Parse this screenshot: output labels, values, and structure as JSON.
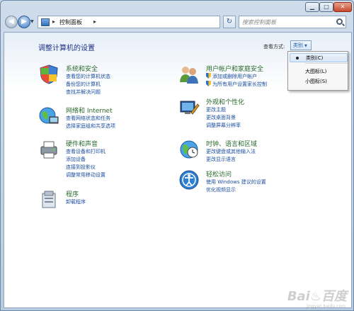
{
  "window": {
    "min_label": "▁",
    "max_label": "□",
    "close_label": "✕"
  },
  "nav": {
    "address_text": "控制面板",
    "search_placeholder": "搜索控制面板"
  },
  "page": {
    "title": "调整计算机的设置",
    "view_by_label": "查看方式:",
    "view_by_value": "类别"
  },
  "view_menu": {
    "items": [
      "类别(C)",
      "大图标(L)",
      "小图标(S)"
    ]
  },
  "categories": {
    "system": {
      "title": "系统和安全",
      "links": [
        "查看您的计算机状态",
        "备份您的计算机",
        "查找并解决问题"
      ]
    },
    "network": {
      "title": "网络和 Internet",
      "links": [
        "查看网络状态和任务",
        "选择家庭组和共享选项"
      ]
    },
    "hardware": {
      "title": "硬件和声音",
      "links": [
        "查看设备和打印机",
        "添加设备",
        "连接到投影仪",
        "调整常用移动设置"
      ]
    },
    "programs": {
      "title": "程序",
      "links": [
        "卸载程序"
      ]
    },
    "users": {
      "title": "用户帐户和家庭安全",
      "links": [
        "添加或删除用户帐户",
        "为所有用户设置家长控制"
      ]
    },
    "appearance": {
      "title": "外观和个性化",
      "links": [
        "更改主题",
        "更改桌面背景",
        "调整屏幕分辨率"
      ]
    },
    "clock": {
      "title": "时钟、语言和区域",
      "links": [
        "更改键盘或其他输入法",
        "更改显示语言"
      ]
    },
    "ease": {
      "title": "轻松访问",
      "links": [
        "使用 Windows 建议的设置",
        "优化视频显示"
      ]
    }
  },
  "watermark": {
    "text": "Bai♨百度",
    "sub": "jingyan.baidu.com"
  },
  "colors": {
    "title_green": "#2b6a2e",
    "link_blue": "#1c4fa0",
    "heading_blue": "#1e3287"
  }
}
